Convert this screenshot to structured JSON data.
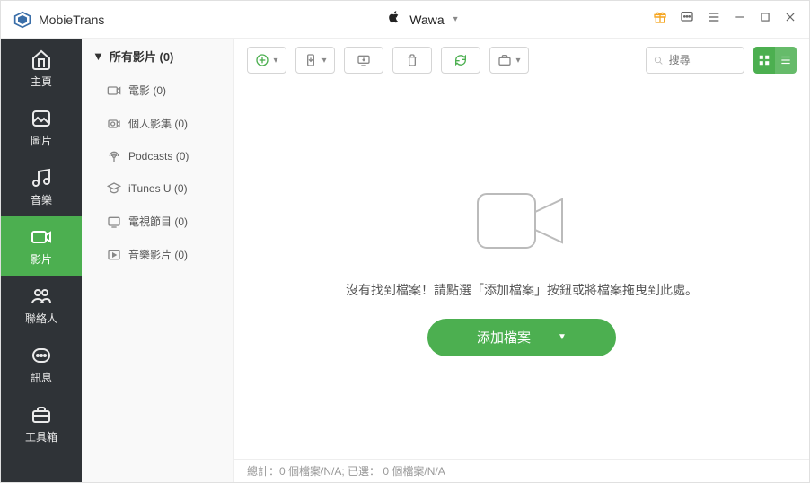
{
  "app_title": "MobieTrans",
  "device": {
    "name": "Wawa"
  },
  "sidebar": {
    "items": [
      {
        "label": "主頁"
      },
      {
        "label": "圖片"
      },
      {
        "label": "音樂"
      },
      {
        "label": "影片"
      },
      {
        "label": "聯絡人"
      },
      {
        "label": "訊息"
      },
      {
        "label": "工具箱"
      }
    ]
  },
  "category": {
    "header": "所有影片 (0)",
    "items": [
      {
        "label": "電影 (0)"
      },
      {
        "label": "個人影集 (0)"
      },
      {
        "label": "Podcasts (0)"
      },
      {
        "label": "iTunes U (0)"
      },
      {
        "label": "電視節目 (0)"
      },
      {
        "label": "音樂影片 (0)"
      }
    ]
  },
  "search": {
    "placeholder": "搜尋"
  },
  "empty": {
    "message": "沒有找到檔案！請點選「添加檔案」按鈕或將檔案拖曳到此處。",
    "button": "添加檔案"
  },
  "status": "總計：0 個檔案/N/A; 已選： 0 個檔案/N/A"
}
